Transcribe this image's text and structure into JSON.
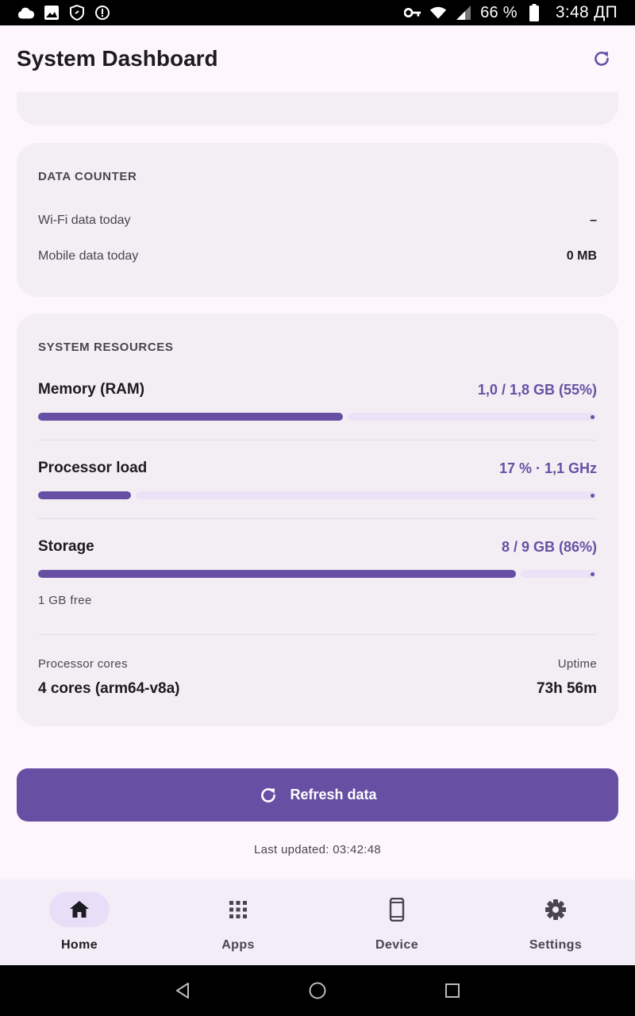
{
  "status_bar": {
    "battery_percent": "66 %",
    "time": "3:48 ДП",
    "icons": [
      "cloud-icon",
      "image-icon",
      "vpn-shield-icon",
      "info-icon",
      "key-icon",
      "wifi-icon",
      "signal-icon",
      "battery-icon"
    ]
  },
  "app_bar": {
    "title": "System Dashboard",
    "refresh_icon": "refresh-icon"
  },
  "data_counter": {
    "title": "DATA COUNTER",
    "rows": [
      {
        "label": "Wi-Fi data today",
        "value": "–"
      },
      {
        "label": "Mobile data today",
        "value": "0 MB"
      }
    ]
  },
  "system_resources": {
    "title": "SYSTEM RESOURCES",
    "metrics": [
      {
        "name": "Memory (RAM)",
        "value": "1,0 / 1,8 GB (55%)",
        "fraction": 0.55
      },
      {
        "name": "Processor load",
        "value": "17 % · 1,1 GHz",
        "fraction": 0.17
      },
      {
        "name": "Storage",
        "value": "8 / 9 GB (86%)",
        "fraction": 0.86,
        "note": "1 GB free"
      }
    ],
    "cores_label": "Processor cores",
    "cores_value": "4 cores (arm64-v8a)",
    "uptime_label": "Uptime",
    "uptime_value": "73h 56m"
  },
  "refresh_button": {
    "label": "Refresh data",
    "icon": "refresh-icon"
  },
  "last_updated": "Last updated: 03:42:48",
  "bottom_nav": {
    "items": [
      {
        "label": "Home",
        "icon": "home-icon",
        "active": true
      },
      {
        "label": "Apps",
        "icon": "apps-grid-icon",
        "active": false
      },
      {
        "label": "Device",
        "icon": "phone-icon",
        "active": false
      },
      {
        "label": "Settings",
        "icon": "gear-icon",
        "active": false
      }
    ]
  },
  "system_nav": {
    "icons": [
      "back-icon",
      "home-circle-icon",
      "recents-icon"
    ]
  },
  "colors": {
    "accent": "#6750a4",
    "track": "#e8def8",
    "card": "#f3eef4",
    "background": "#fdf7fd"
  }
}
